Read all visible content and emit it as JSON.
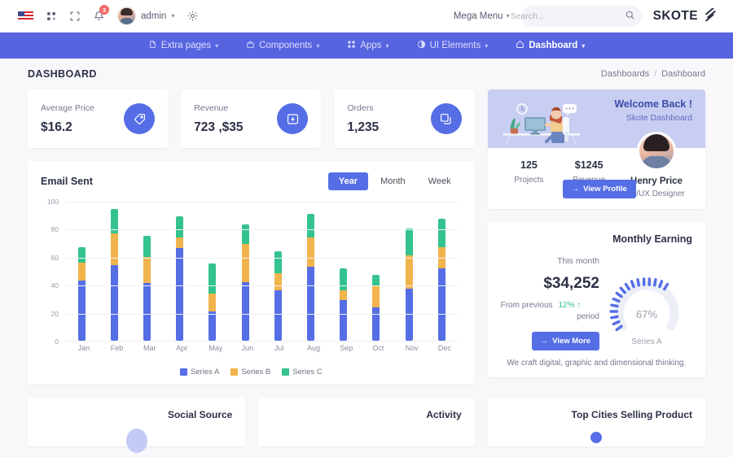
{
  "topbar": {
    "brand": "SKOTE",
    "brand_icon": "skote-logo-icon",
    "mega_menu": "Mega Menu",
    "search_placeholder": "Search...",
    "search_value": "",
    "search_icon": "search-icon",
    "admin_label": "admin",
    "notification_count": "3",
    "settings_icon": "gear-icon",
    "bell_icon": "bell-icon",
    "fullscreen_icon": "fullscreen-icon",
    "apps_icon": "apps-grid-icon",
    "flag_icon": "us-flag-icon",
    "avatar_icon": "user-avatar"
  },
  "nav": {
    "items": [
      {
        "label": "Dashboard",
        "icon": "home-icon",
        "active": true
      },
      {
        "label": "UI Elements",
        "icon": "circle-half-icon",
        "active": false
      },
      {
        "label": "Apps",
        "icon": "apps-icon",
        "active": false
      },
      {
        "label": "Components",
        "icon": "briefcase-icon",
        "active": false
      },
      {
        "label": "Extra pages",
        "icon": "file-icon",
        "active": false
      }
    ]
  },
  "page": {
    "title": "DASHBOARD",
    "breadcrumb": [
      "Dashboard",
      "Dashboards"
    ],
    "breadcrumb_separator": "/"
  },
  "stats": [
    {
      "label": "Orders",
      "value": "1,235",
      "icon": "copy-stack-icon"
    },
    {
      "label": "Revenue",
      "value": "723 ,$35",
      "icon": "archive-box-icon"
    },
    {
      "label": "Average Price",
      "value": "$16.2",
      "icon": "tag-icon"
    }
  ],
  "email_chart": {
    "title": "Email Sent",
    "ranges": [
      {
        "label": "Year",
        "active": true
      },
      {
        "label": "Month",
        "active": false
      },
      {
        "label": "Week",
        "active": false
      }
    ],
    "legend": [
      {
        "label": "Series C",
        "color": "#34c38f"
      },
      {
        "label": "Series B",
        "color": "#f1b44c"
      },
      {
        "label": "Series A",
        "color": "#556ee6"
      }
    ]
  },
  "chart_data": {
    "type": "bar",
    "title": "Email Sent",
    "stacked": true,
    "categories": [
      "Jan",
      "Feb",
      "Mar",
      "Apr",
      "May",
      "Jun",
      "Jul",
      "Aug",
      "Sep",
      "Oct",
      "Nov",
      "Dec"
    ],
    "series": [
      {
        "name": "Series A",
        "color": "#556ee6",
        "values": [
          43,
          54,
          41,
          66,
          21,
          42,
          36,
          53,
          29,
          24,
          37,
          52
        ]
      },
      {
        "name": "Series B",
        "color": "#f1b44c",
        "values": [
          13,
          23,
          19,
          8,
          13,
          27,
          12,
          21,
          7,
          15,
          24,
          15
        ]
      },
      {
        "name": "Series C",
        "color": "#34c38f",
        "values": [
          11,
          17,
          15,
          15,
          21,
          14,
          16,
          17,
          16,
          8,
          19,
          20
        ]
      }
    ],
    "totals": [
      67,
      94,
      75,
      89,
      55,
      83,
      64,
      91,
      52,
      47,
      80,
      87
    ],
    "xlabel": "",
    "ylabel": "",
    "ylim": [
      0,
      100
    ],
    "yticks": [
      0,
      20,
      40,
      60,
      80,
      100
    ],
    "grid": true,
    "legend_position": "bottom"
  },
  "welcome": {
    "heading": "! Welcome Back",
    "subheading": "Skote Dashboard",
    "illustration": "desk-workspace-illustration",
    "user_name": "Henry Price",
    "user_role": "UI/UX Designer",
    "stats": [
      {
        "value": "$1245",
        "label": "Revenue"
      },
      {
        "value": "125",
        "label": "Projects"
      }
    ],
    "button": "View Profile",
    "button_icon": "arrow-right-icon"
  },
  "earning": {
    "title": "Monthly Earning",
    "month_label": "This month",
    "amount": "$34,252",
    "from_previous": "From previous",
    "change": "12%",
    "change_icon": "arrow-up-icon",
    "period": "period",
    "gauge_percent": "67%",
    "gauge_value": 67,
    "gauge_series": "Series A",
    "gauge_color": "#556ee6",
    "button": "View More",
    "button_icon": "arrow-right-icon",
    "footer": ".We craft digital, graphic and dimensional thinking"
  },
  "bottom_cards": [
    {
      "title": "Top Cities Selling Product"
    },
    {
      "title": "Activity"
    },
    {
      "title": "Social Source"
    }
  ],
  "colors": {
    "primary": "#556ee6",
    "navbar": "#5764e0",
    "success": "#34c38f",
    "warning": "#f1b44c",
    "danger": "#f46a6a",
    "body_bg": "#f8f8fb"
  }
}
